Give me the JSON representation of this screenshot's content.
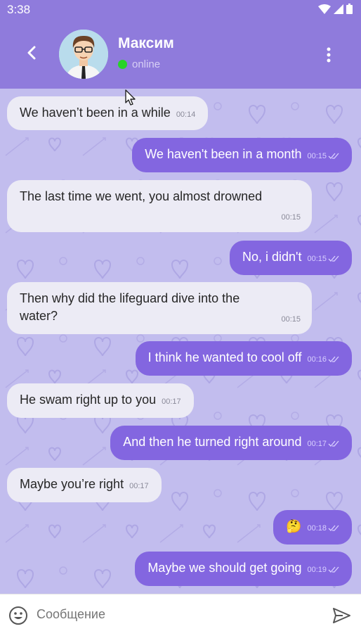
{
  "status_bar": {
    "time": "3:38"
  },
  "header": {
    "name": "Максим",
    "status": "online",
    "avatar_icon": "avatar-man-glasses",
    "back_icon": "chevron-left-icon",
    "menu_icon": "more-vert-icon"
  },
  "messages": [
    {
      "dir": "in",
      "text": "We haven’t been in a while",
      "time": "00:14"
    },
    {
      "dir": "out",
      "text": "We haven't been in a month",
      "time": "00:15"
    },
    {
      "dir": "in",
      "text": "The last time we went, you almost drowned",
      "time": "00:15"
    },
    {
      "dir": "out",
      "text": "No, i didn't",
      "time": "00:15"
    },
    {
      "dir": "in",
      "text": "Then why did the lifeguard dive into the water?",
      "time": "00:15"
    },
    {
      "dir": "out",
      "text": "I think he wanted to cool off",
      "time": "00:16"
    },
    {
      "dir": "in",
      "text": "He swam right up to you",
      "time": "00:17"
    },
    {
      "dir": "out",
      "text": "And then he turned right around",
      "time": "00:17"
    },
    {
      "dir": "in",
      "text": "Maybe you’re right",
      "time": "00:17"
    },
    {
      "dir": "out",
      "text": "🤔",
      "time": "00:18"
    },
    {
      "dir": "out",
      "text": "Maybe we should get going",
      "time": "00:19"
    }
  ],
  "composer": {
    "placeholder": "Сообщение",
    "emoji_icon": "emoji-icon",
    "send_icon": "send-icon"
  },
  "colors": {
    "header": "#8f7bdc",
    "chat_bg": "#c2bdee",
    "incoming": "#ecebf5",
    "outgoing": "#8366e0",
    "online": "#27d427"
  }
}
